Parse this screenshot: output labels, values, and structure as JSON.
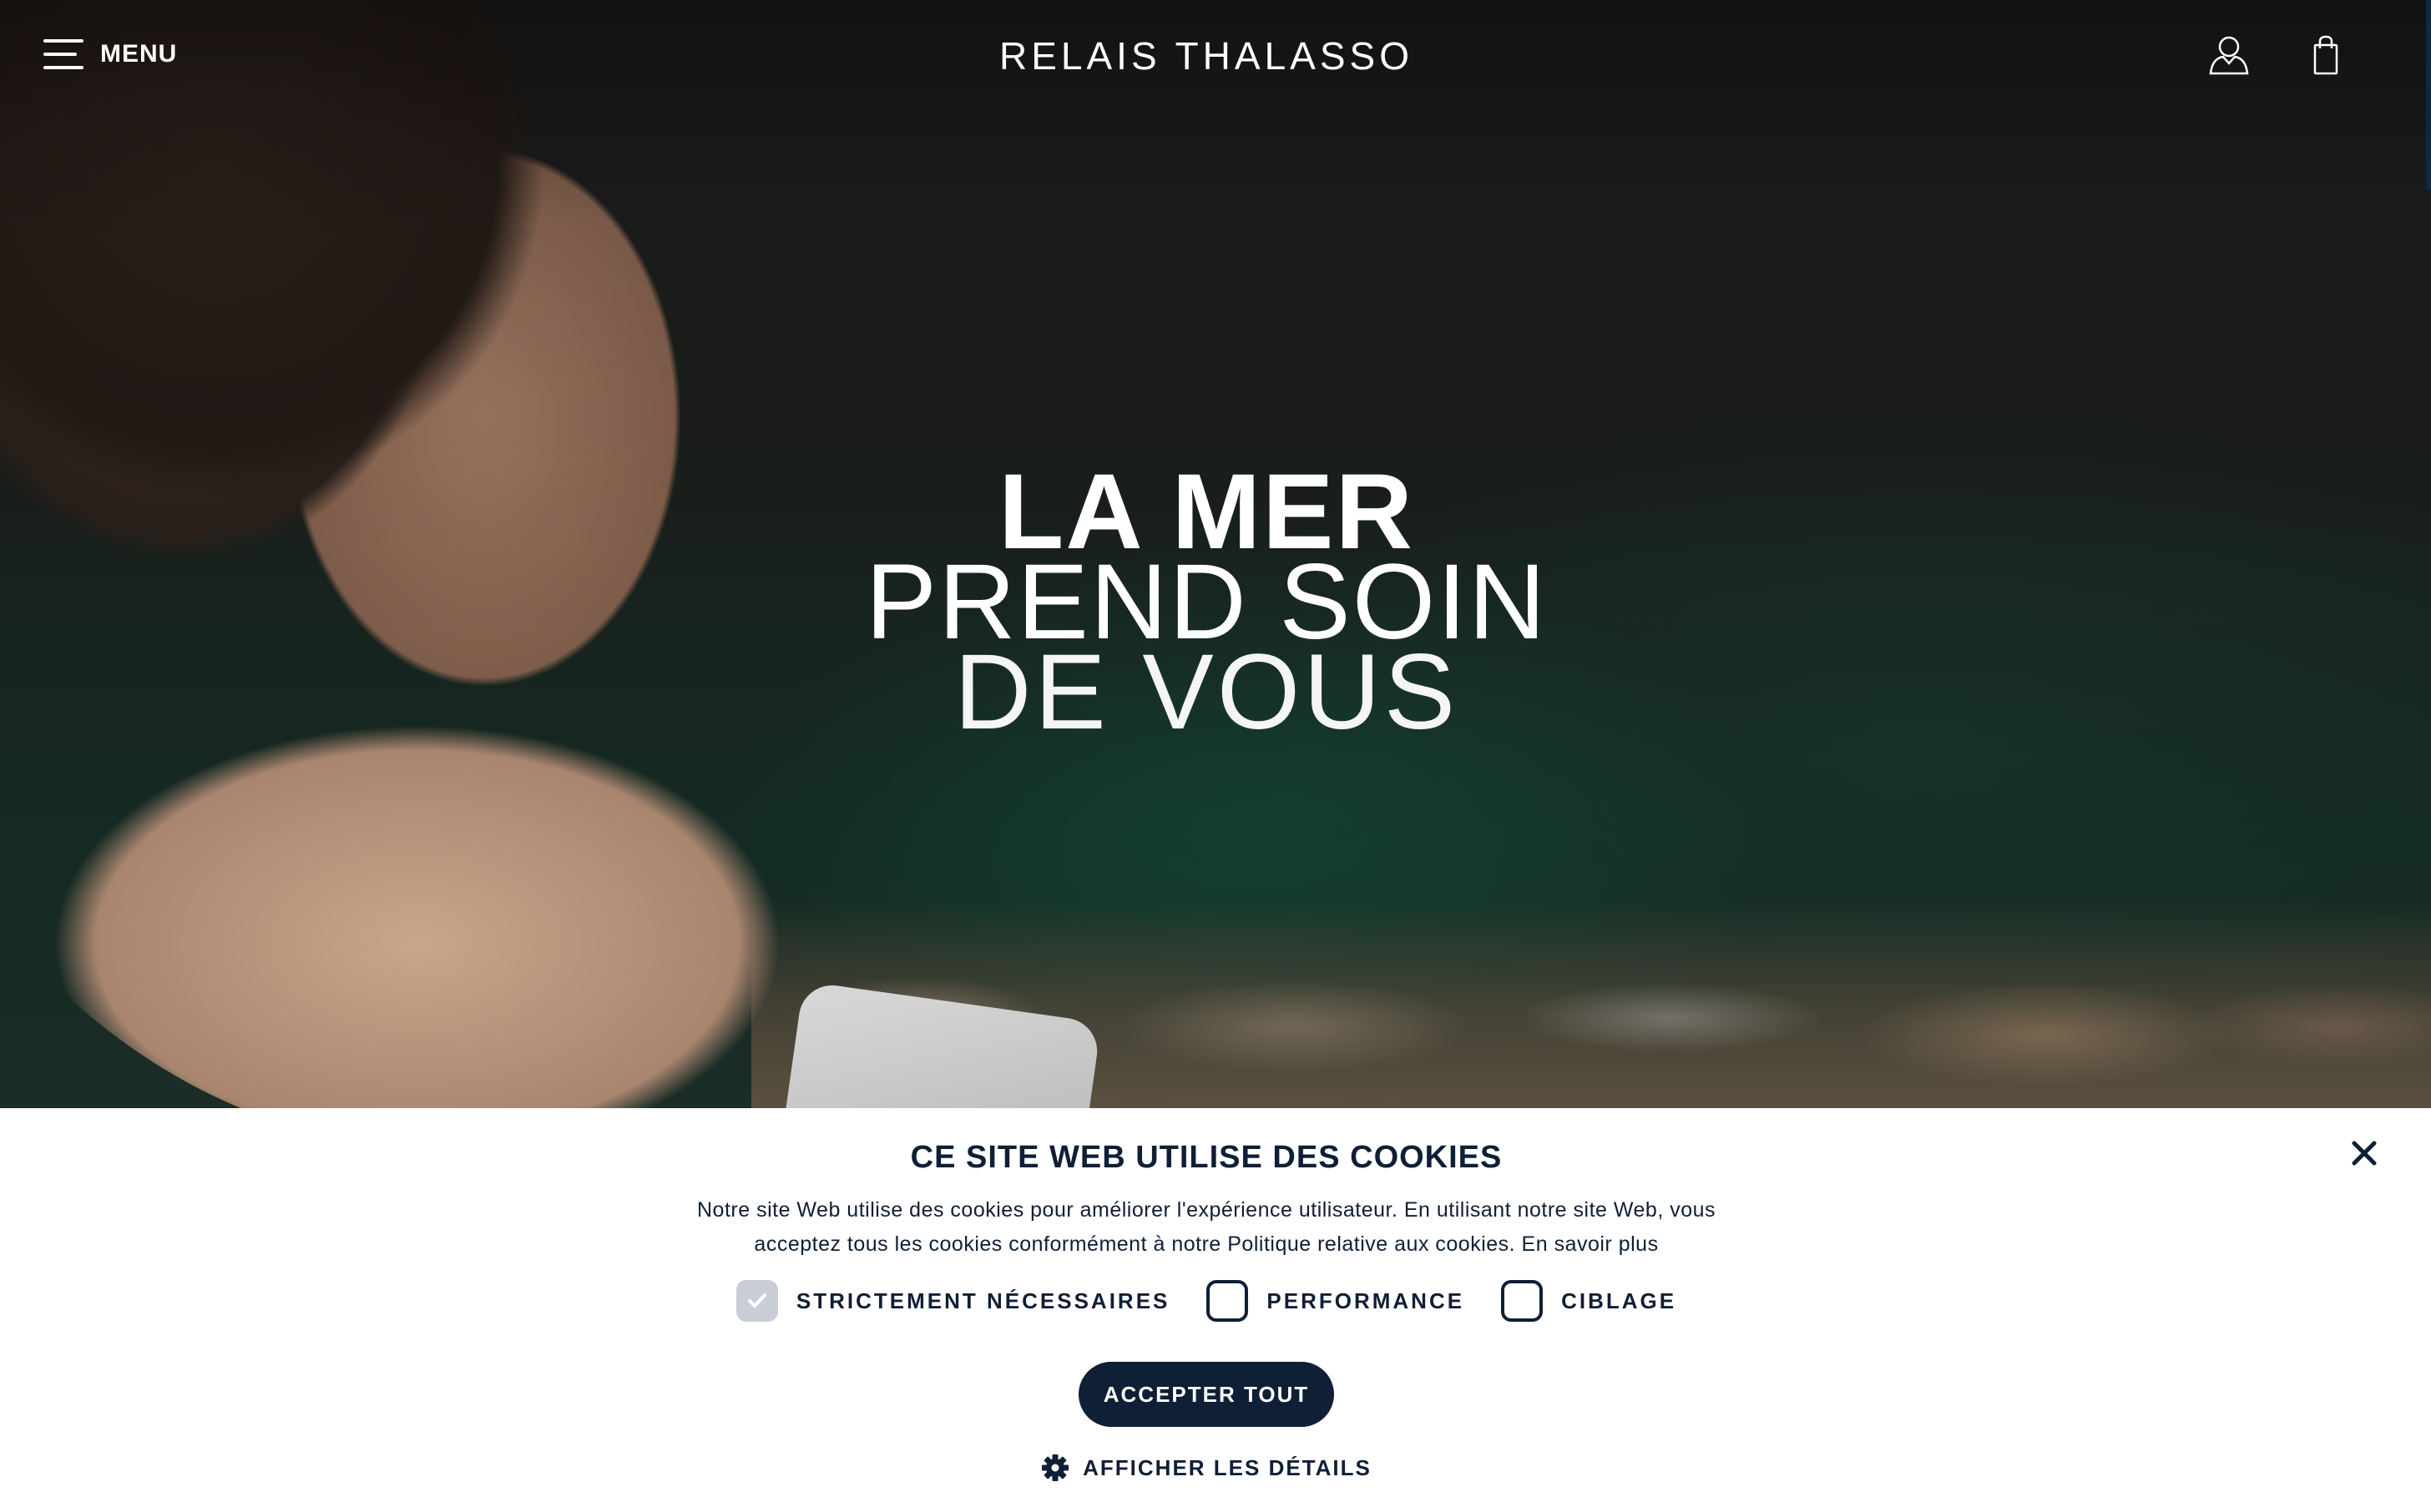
{
  "header": {
    "menu_label": "MENU",
    "brand": "RELAIS THALASSO",
    "icons": [
      "user-icon",
      "shopping-bag-icon"
    ]
  },
  "hero": {
    "line1": "LA MER",
    "line2": "PREND SOIN",
    "line3": "DE VOUS"
  },
  "cookie_banner": {
    "title": "CE SITE WEB UTILISE DES COOKIES",
    "text_line1": "Notre site Web utilise des cookies pour améliorer l'expérience utilisateur. En utilisant notre site Web, vous",
    "text_line2": "acceptez tous les cookies conformément à notre Politique relative aux cookies. En savoir plus",
    "options": [
      {
        "label": "STRICTEMENT NÉCESSAIRES",
        "checked": true,
        "disabled": true
      },
      {
        "label": "PERFORMANCE",
        "checked": false
      },
      {
        "label": "CIBLAGE",
        "checked": false
      }
    ],
    "accept_label": "ACCEPTER TOUT",
    "details_label": "AFFICHER LES DÉTAILS"
  },
  "colors": {
    "navy": "#0e1f36",
    "white": "#ffffff",
    "checkbox_disabled": "#c8cdd6"
  }
}
